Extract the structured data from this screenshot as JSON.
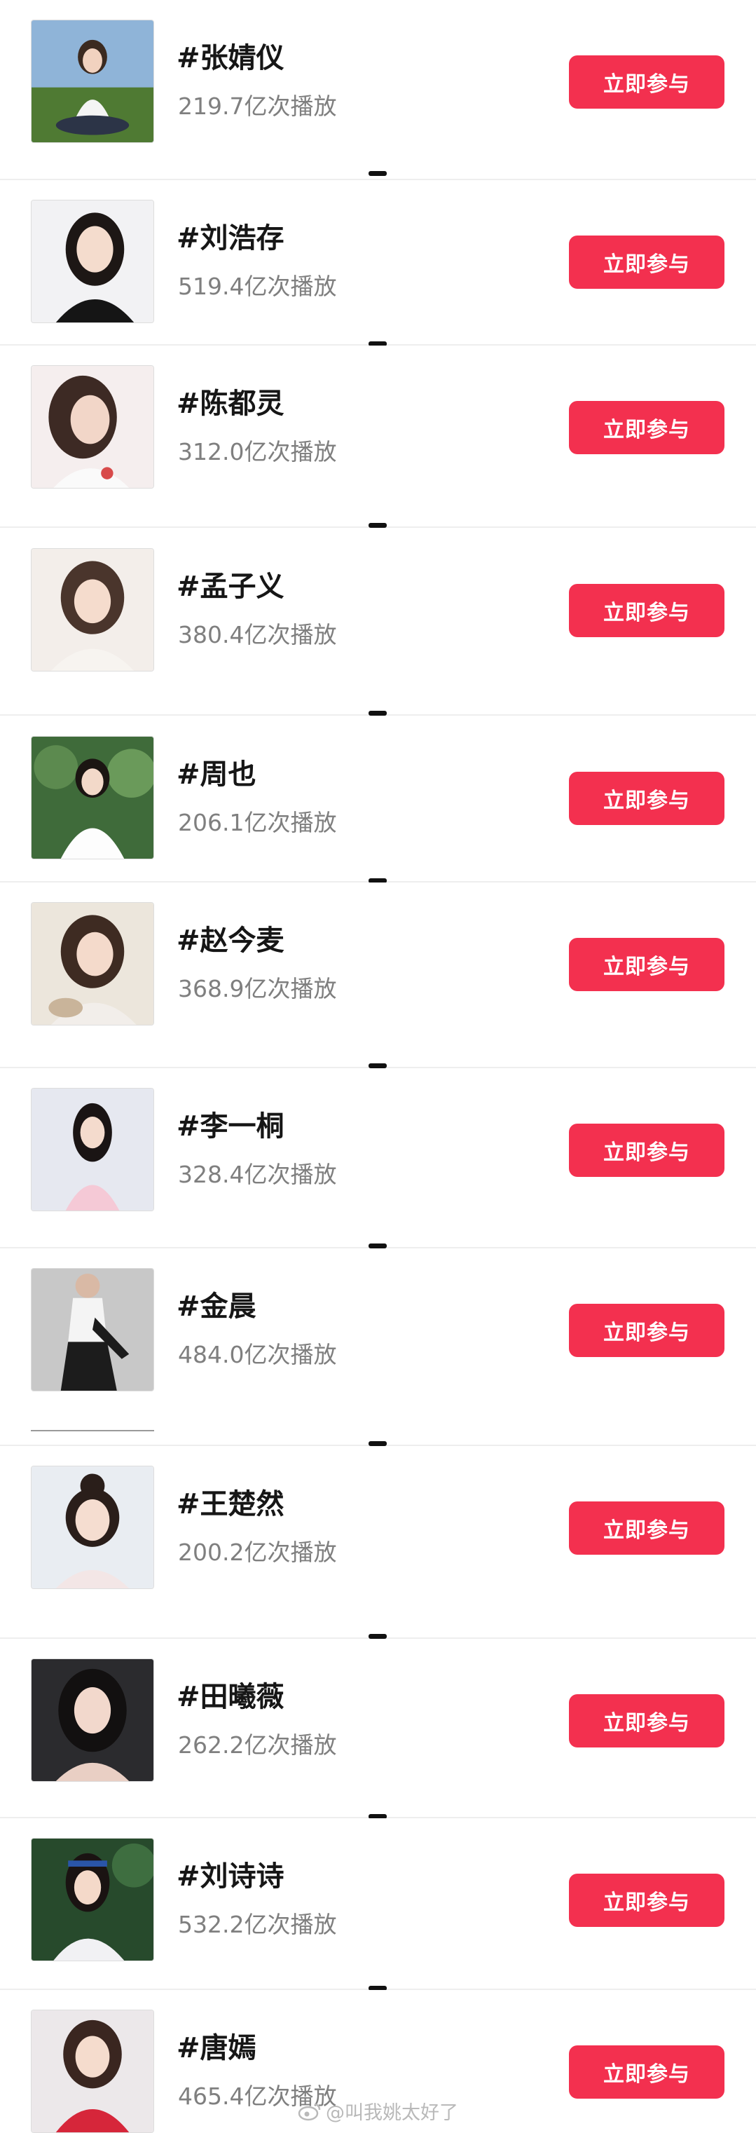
{
  "accent": "#f3304f",
  "items": [
    {
      "tag": "#张婧仪",
      "plays": "219.7亿次播放",
      "button": "立即参与"
    },
    {
      "tag": "#刘浩存",
      "plays": "519.4亿次播放",
      "button": "立即参与"
    },
    {
      "tag": "#陈都灵",
      "plays": "312.0亿次播放",
      "button": "立即参与"
    },
    {
      "tag": "#孟子义",
      "plays": "380.4亿次播放",
      "button": "立即参与"
    },
    {
      "tag": "#周也",
      "plays": "206.1亿次播放",
      "button": "立即参与"
    },
    {
      "tag": "#赵今麦",
      "plays": "368.9亿次播放",
      "button": "立即参与"
    },
    {
      "tag": "#李一桐",
      "plays": "328.4亿次播放",
      "button": "立即参与"
    },
    {
      "tag": "#金晨",
      "plays": "484.0亿次播放",
      "button": "立即参与"
    },
    {
      "tag": "#王楚然",
      "plays": "200.2亿次播放",
      "button": "立即参与"
    },
    {
      "tag": "#田曦薇",
      "plays": "262.2亿次播放",
      "button": "立即参与"
    },
    {
      "tag": "#刘诗诗",
      "plays": "532.2亿次播放",
      "button": "立即参与"
    },
    {
      "tag": "#唐嫣",
      "plays": "465.4亿次播放",
      "button": "立即参与"
    }
  ],
  "watermark": "@叫我姚太好了"
}
